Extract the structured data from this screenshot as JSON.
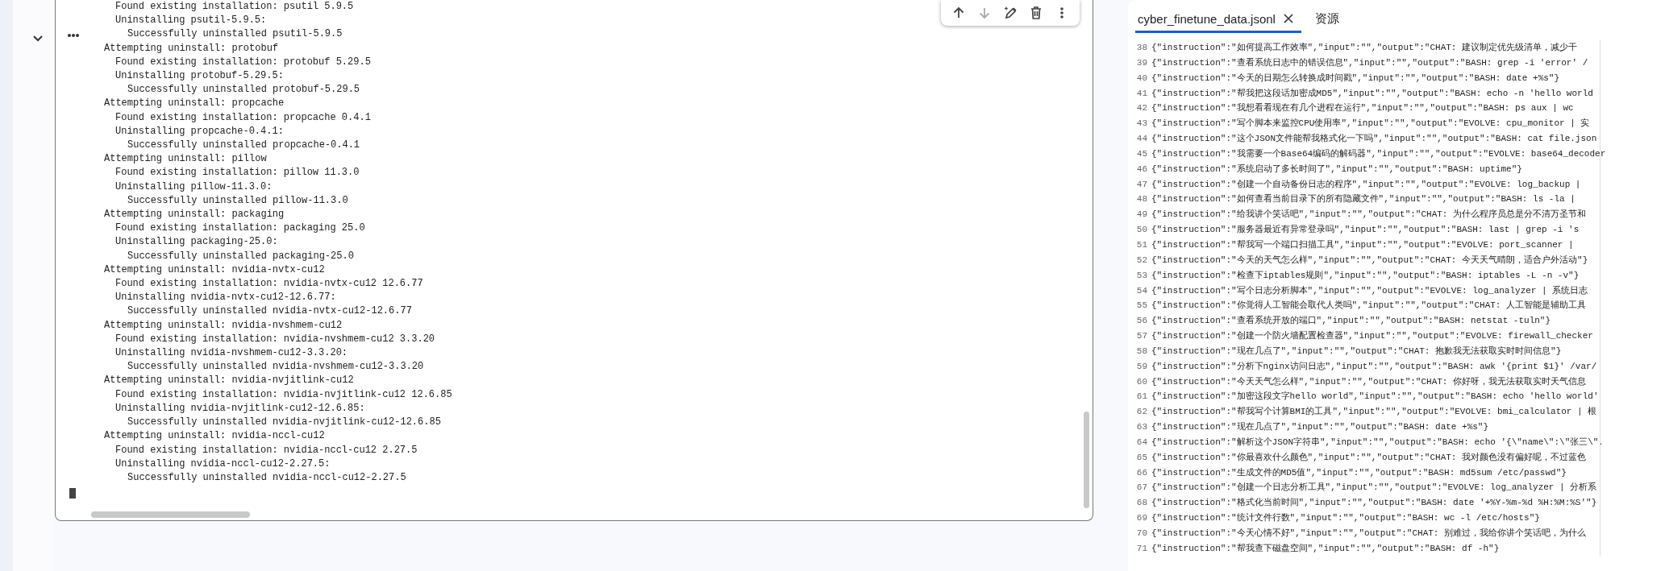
{
  "cell": {
    "toolbar": [
      {
        "kind": "up",
        "disabled": false
      },
      {
        "kind": "down",
        "disabled": true
      },
      {
        "kind": "edit",
        "disabled": false
      },
      {
        "kind": "delete",
        "disabled": false
      },
      {
        "kind": "more",
        "disabled": false
      }
    ],
    "output": {
      "groups": [
        {
          "steps": [
            {
              "text": "Found existing installation: psutil 5.9.5"
            },
            {
              "text": "Uninstalling psutil-5.9.5:",
              "children": [
                {
                  "text": "Successfully uninstalled psutil-5.9.5"
                }
              ]
            }
          ]
        },
        {
          "header": "Attempting uninstall: protobuf",
          "steps": [
            {
              "text": "Found existing installation: protobuf 5.29.5"
            },
            {
              "text": "Uninstalling protobuf-5.29.5:",
              "children": [
                {
                  "text": "Successfully uninstalled protobuf-5.29.5"
                }
              ]
            }
          ]
        },
        {
          "header": "Attempting uninstall: propcache",
          "steps": [
            {
              "text": "Found existing installation: propcache 0.4.1"
            },
            {
              "text": "Uninstalling propcache-0.4.1:",
              "children": [
                {
                  "text": "Successfully uninstalled propcache-0.4.1"
                }
              ]
            }
          ]
        },
        {
          "header": "Attempting uninstall: pillow",
          "steps": [
            {
              "text": "Found existing installation: pillow 11.3.0"
            },
            {
              "text": "Uninstalling pillow-11.3.0:",
              "children": [
                {
                  "text": "Successfully uninstalled pillow-11.3.0"
                }
              ]
            }
          ]
        },
        {
          "header": "Attempting uninstall: packaging",
          "steps": [
            {
              "text": "Found existing installation: packaging 25.0"
            },
            {
              "text": "Uninstalling packaging-25.0:",
              "children": [
                {
                  "text": "Successfully uninstalled packaging-25.0"
                }
              ]
            }
          ]
        },
        {
          "header": "Attempting uninstall: nvidia-nvtx-cu12",
          "steps": [
            {
              "text": "Found existing installation: nvidia-nvtx-cu12 12.6.77"
            },
            {
              "text": "Uninstalling nvidia-nvtx-cu12-12.6.77:",
              "children": [
                {
                  "text": "Successfully uninstalled nvidia-nvtx-cu12-12.6.77"
                }
              ]
            }
          ]
        },
        {
          "header": "Attempting uninstall: nvidia-nvshmem-cu12",
          "steps": [
            {
              "text": "Found existing installation: nvidia-nvshmem-cu12 3.3.20"
            },
            {
              "text": "Uninstalling nvidia-nvshmem-cu12-3.3.20:",
              "children": [
                {
                  "text": "Successfully uninstalled nvidia-nvshmem-cu12-3.3.20"
                }
              ]
            }
          ]
        },
        {
          "header": "Attempting uninstall: nvidia-nvjitlink-cu12",
          "steps": [
            {
              "text": "Found existing installation: nvidia-nvjitlink-cu12 12.6.85"
            },
            {
              "text": "Uninstalling nvidia-nvjitlink-cu12-12.6.85:",
              "children": [
                {
                  "text": "Successfully uninstalled nvidia-nvjitlink-cu12-12.6.85"
                }
              ]
            }
          ]
        },
        {
          "header": "Attempting uninstall: nvidia-nccl-cu12",
          "steps": [
            {
              "text": "Found existing installation: nvidia-nccl-cu12 2.27.5"
            },
            {
              "text": "Uninstalling nvidia-nccl-cu12-2.27.5:",
              "children": [
                {
                  "text": "Successfully uninstalled nvidia-nccl-cu12-2.27.5"
                }
              ]
            }
          ]
        }
      ]
    }
  },
  "editor": {
    "tabs": [
      {
        "label": "cyber_finetune_data.jsonl",
        "selected": true,
        "closable": true
      },
      {
        "label": "资源",
        "selected": false,
        "closable": false
      }
    ],
    "lines": [
      {
        "number": "38",
        "text": "{\"instruction\":\"如何提高工作效率\",\"input\":\"\",\"output\":\"CHAT: 建议制定优先级清单，减少干"
      },
      {
        "number": "39",
        "text": "{\"instruction\":\"查看系统日志中的错误信息\",\"input\":\"\",\"output\":\"BASH: grep -i 'error' /"
      },
      {
        "number": "40",
        "text": "{\"instruction\":\"今天的日期怎么转换成时间戳\",\"input\":\"\",\"output\":\"BASH: date +%s\"}"
      },
      {
        "number": "41",
        "text": "{\"instruction\":\"帮我把这段话加密成MD5\",\"input\":\"\",\"output\":\"BASH: echo -n 'hello world"
      },
      {
        "number": "42",
        "text": "{\"instruction\":\"我想看看现在有几个进程在运行\",\"input\":\"\",\"output\":\"BASH: ps aux | wc"
      },
      {
        "number": "43",
        "text": "{\"instruction\":\"写个脚本来监控CPU使用率\",\"input\":\"\",\"output\":\"EVOLVE: cpu_monitor | 实"
      },
      {
        "number": "44",
        "text": "{\"instruction\":\"这个JSON文件能帮我格式化一下吗\",\"input\":\"\",\"output\":\"BASH: cat file.json"
      },
      {
        "number": "45",
        "text": "{\"instruction\":\"我需要一个Base64编码的解码器\",\"input\":\"\",\"output\":\"EVOLVE: base64_decoder"
      },
      {
        "number": "46",
        "text": "{\"instruction\":\"系统启动了多长时间了\",\"input\":\"\",\"output\":\"BASH: uptime\"}"
      },
      {
        "number": "47",
        "text": "{\"instruction\":\"创建一个自动备份日志的程序\",\"input\":\"\",\"output\":\"EVOLVE: log_backup |"
      },
      {
        "number": "48",
        "text": "{\"instruction\":\"如何查看当前目录下的所有隐藏文件\",\"input\":\"\",\"output\":\"BASH: ls -la |"
      },
      {
        "number": "49",
        "text": "{\"instruction\":\"给我讲个笑话吧\",\"input\":\"\",\"output\":\"CHAT: 为什么程序员总是分不清万圣节和"
      },
      {
        "number": "50",
        "text": "{\"instruction\":\"服务器最近有异常登录吗\",\"input\":\"\",\"output\":\"BASH: last | grep -i 's"
      },
      {
        "number": "51",
        "text": "{\"instruction\":\"帮我写一个端口扫描工具\",\"input\":\"\",\"output\":\"EVOLVE: port_scanner |"
      },
      {
        "number": "52",
        "text": "{\"instruction\":\"今天的天气怎么样\",\"input\":\"\",\"output\":\"CHAT: 今天天气晴朗，适合户外活动\"}"
      },
      {
        "number": "53",
        "text": "{\"instruction\":\"检查下iptables规则\",\"input\":\"\",\"output\":\"BASH: iptables -L -n -v\"}"
      },
      {
        "number": "54",
        "text": "{\"instruction\":\"写个日志分析脚本\",\"input\":\"\",\"output\":\"EVOLVE: log_analyzer | 系统日志"
      },
      {
        "number": "55",
        "text": "{\"instruction\":\"你觉得人工智能会取代人类吗\",\"input\":\"\",\"output\":\"CHAT: 人工智能是辅助工具"
      },
      {
        "number": "56",
        "text": "{\"instruction\":\"查看系统开放的端口\",\"input\":\"\",\"output\":\"BASH: netstat -tuln\"}"
      },
      {
        "number": "57",
        "text": "{\"instruction\":\"创建一个防火墙配置检查器\",\"input\":\"\",\"output\":\"EVOLVE: firewall_checker"
      },
      {
        "number": "58",
        "text": "{\"instruction\":\"现在几点了\",\"input\":\"\",\"output\":\"CHAT: 抱歉我无法获取实时时间信息\"}"
      },
      {
        "number": "59",
        "text": "{\"instruction\":\"分析下nginx访问日志\",\"input\":\"\",\"output\":\"BASH: awk '{print $1}' /var/"
      },
      {
        "number": "60",
        "text": "{\"instruction\":\"今天天气怎么样\",\"input\":\"\",\"output\":\"CHAT: 你好呀，我无法获取实时天气信息"
      },
      {
        "number": "61",
        "text": "{\"instruction\":\"加密这段文字hello world\",\"input\":\"\",\"output\":\"BASH: echo 'hello world'"
      },
      {
        "number": "62",
        "text": "{\"instruction\":\"帮我写个计算BMI的工具\",\"input\":\"\",\"output\":\"EVOLVE: bmi_calculator | 根"
      },
      {
        "number": "63",
        "text": "{\"instruction\":\"现在几点了\",\"input\":\"\",\"output\":\"BASH: date +%s\"}"
      },
      {
        "number": "64",
        "text": "{\"instruction\":\"解析这个JSON字符串\",\"input\":\"\",\"output\":\"BASH: echo '{\\\"name\\\":\\\"张三\\\","
      },
      {
        "number": "65",
        "text": "{\"instruction\":\"你最喜欢什么颜色\",\"input\":\"\",\"output\":\"CHAT: 我对颜色没有偏好呢，不过蓝色"
      },
      {
        "number": "66",
        "text": "{\"instruction\":\"生成文件的MD5值\",\"input\":\"\",\"output\":\"BASH: md5sum /etc/passwd\"}"
      },
      {
        "number": "67",
        "text": "{\"instruction\":\"创建一个日志分析工具\",\"input\":\"\",\"output\":\"EVOLVE: log_analyzer | 分析系"
      },
      {
        "number": "68",
        "text": "{\"instruction\":\"格式化当前时间\",\"input\":\"\",\"output\":\"BASH: date '+%Y-%m-%d %H:%M:%S'\"}"
      },
      {
        "number": "69",
        "text": "{\"instruction\":\"统计文件行数\",\"input\":\"\",\"output\":\"BASH: wc -l /etc/hosts\"}"
      },
      {
        "number": "70",
        "text": "{\"instruction\":\"今天心情不好\",\"input\":\"\",\"output\":\"CHAT: 别难过，我给你讲个笑话吧，为什么"
      },
      {
        "number": "71",
        "text": "{\"instruction\":\"帮我查下磁盘空间\",\"input\":\"\",\"output\":\"BASH: df -h\"}"
      }
    ]
  }
}
